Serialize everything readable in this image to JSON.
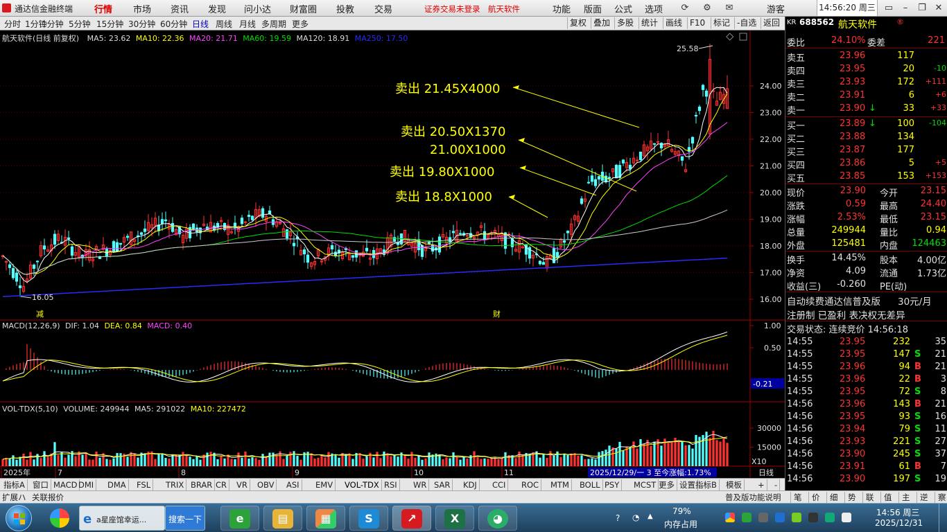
{
  "app": {
    "title": "通达信金融终端",
    "menu": [
      "行情",
      "市场",
      "资讯",
      "发现",
      "问小达",
      "财富圈",
      "投教",
      "交易"
    ],
    "notice_login": "证券交易未登录",
    "notice_stock": "航天软件",
    "right_menu": [
      "功能",
      "版面",
      "公式",
      "选项"
    ],
    "user": "游客",
    "clock": "14:56:20 周三",
    "brand_color": "#d71920"
  },
  "toolbar": {
    "periods": [
      "分时",
      "1分钟",
      "5分钟",
      "15分钟",
      "30分钟",
      "60分钟",
      "日线",
      "周线",
      "月线",
      "多周期",
      "更多"
    ],
    "active_period": "日线",
    "right_buttons": [
      "复权",
      "叠加",
      "多股",
      "统计",
      "画线",
      "F10",
      "标记",
      "-自选",
      "返回"
    ]
  },
  "chart_header": {
    "title": "航天软件(日线 前复权)",
    "ma": [
      {
        "label": "MA5:",
        "value": "23.62",
        "color": "#ffffff"
      },
      {
        "label": "MA10:",
        "value": "22.36",
        "color": "#ffff00"
      },
      {
        "label": "MA20:",
        "value": "21.71",
        "color": "#ff00ff"
      },
      {
        "label": "MA60:",
        "value": "19.59",
        "color": "#00e000"
      },
      {
        "label": "MA120:",
        "value": "18.91",
        "color": "#dddddd"
      },
      {
        "label": "MA250:",
        "value": "17.50",
        "color": "#0000ff"
      }
    ],
    "price_axis": [
      "24.00",
      "23.00",
      "22.00",
      "21.00",
      "20.00",
      "19.00",
      "18.00",
      "17.00",
      "16.00"
    ],
    "high_mark": "25.58",
    "low_mark": "16.05",
    "markers": [
      "减",
      "财"
    ]
  },
  "annotations": [
    {
      "label": "卖出",
      "value": "21.45X4000"
    },
    {
      "label": "卖出",
      "value": "20.50X1370",
      "value2": "21.00X1000"
    },
    {
      "label": "卖出",
      "value": "19.80X1000"
    },
    {
      "label": "卖出",
      "value": "18.8X1000"
    }
  ],
  "macd": {
    "title": "MACD(12,26,9)",
    "dif_label": "DIF:",
    "dif": "1.04",
    "dea_label": "DEA:",
    "dea": "0.84",
    "macd_label": "MACD:",
    "macd": "0.40",
    "axis": [
      "1.00",
      "0.50"
    ],
    "cursor": "-0.21"
  },
  "vol": {
    "title": "VOL-TDX(5,10)",
    "volume_label": "VOLUME:",
    "volume": "249944",
    "ma5_label": "MA5:",
    "ma5": "291022",
    "ma10_label": "MA10:",
    "ma10": "227472",
    "axis": [
      "30000",
      "15000"
    ],
    "unit": "X10"
  },
  "time_axis": {
    "labels": [
      "2025年",
      "7",
      "8",
      "9",
      "10",
      "11"
    ],
    "range": "2025/12/29/一 3 至今涨幅:1.73%",
    "period": "日线"
  },
  "indicator_tabs": [
    "指标A",
    "窗口",
    "MACD",
    "DMI",
    "DMA",
    "FSL",
    "TRIX",
    "BRAR",
    "CR",
    "VR",
    "OBV",
    "ASI",
    "EMV",
    "VOL-TDX",
    "RSI",
    "WR",
    "SAR",
    "KDJ",
    "CCI",
    "ROC",
    "MTM",
    "BOLL",
    "PSY",
    "MCST",
    "更多",
    "设置"
  ],
  "indicator_right": [
    "指标B",
    "模板",
    "+",
    "-"
  ],
  "status": {
    "left": [
      "扩展ハ",
      "关联报价"
    ],
    "right": "普及版功能说明",
    "keys": [
      "笔",
      "价",
      "细",
      "势",
      "联",
      "值",
      "主",
      "逆",
      "察"
    ]
  },
  "quote": {
    "tag": "KR",
    "code": "688562",
    "name": "航天软件",
    "wb_label": "委比",
    "wb": "24.10%",
    "wc_label": "委差",
    "wc": "221",
    "asks": [
      {
        "label": "卖五",
        "price": "23.96",
        "vol": "117",
        "chg": ""
      },
      {
        "label": "卖四",
        "price": "23.95",
        "vol": "20",
        "chg": "-10"
      },
      {
        "label": "卖三",
        "price": "23.93",
        "vol": "172",
        "chg": "+111"
      },
      {
        "label": "卖二",
        "price": "23.91",
        "vol": "6",
        "chg": "+6"
      },
      {
        "label": "卖一",
        "price": "23.90",
        "vol": "33",
        "chg": "+33",
        "arrow": "↓"
      }
    ],
    "bids": [
      {
        "label": "买一",
        "price": "23.89",
        "vol": "100",
        "chg": "-104",
        "arrow": "↓"
      },
      {
        "label": "买二",
        "price": "23.88",
        "vol": "134",
        "chg": ""
      },
      {
        "label": "买三",
        "price": "23.87",
        "vol": "177",
        "chg": ""
      },
      {
        "label": "买四",
        "price": "23.86",
        "vol": "5",
        "chg": "+5"
      },
      {
        "label": "买五",
        "price": "23.85",
        "vol": "153",
        "chg": "+153"
      }
    ],
    "stats": [
      {
        "l1": "现价",
        "v1": "23.90",
        "l2": "今开",
        "v2": "23.15"
      },
      {
        "l1": "涨跌",
        "v1": "0.59",
        "l2": "最高",
        "v2": "24.40"
      },
      {
        "l1": "涨幅",
        "v1": "2.53%",
        "l2": "最低",
        "v2": "23.15"
      },
      {
        "l1": "总量",
        "v1": "249944",
        "l2": "量比",
        "v2": "0.94"
      },
      {
        "l1": "外盘",
        "v1": "125481",
        "l2": "内盘",
        "v2": "124463"
      }
    ],
    "stats2": [
      {
        "l1": "换手",
        "v1": "14.45%",
        "l2": "股本",
        "v2": "4.00亿"
      },
      {
        "l1": "净资",
        "v1": "4.09",
        "l2": "流通",
        "v2": "1.73亿"
      },
      {
        "l1": "收益(三)",
        "v1": "-0.260",
        "l2": "PE(动)",
        "v2": ""
      }
    ],
    "promo1": "自动续费通达信普及版",
    "promo_price": "30元/月",
    "promo2": "注册制 已盈利 表决权无差异",
    "trade_status": "交易状态: 连续竞价 14:56:18",
    "ticks": [
      {
        "t": "14:55",
        "p": "23.95",
        "v": "232",
        "d": "",
        "n": "35"
      },
      {
        "t": "14:55",
        "p": "23.95",
        "v": "147",
        "d": "S",
        "n": "21"
      },
      {
        "t": "14:55",
        "p": "23.96",
        "v": "94",
        "d": "B",
        "n": "21"
      },
      {
        "t": "14:55",
        "p": "23.96",
        "v": "22",
        "d": "B",
        "n": "3"
      },
      {
        "t": "14:55",
        "p": "23.95",
        "v": "72",
        "d": "S",
        "n": "8"
      },
      {
        "t": "14:56",
        "p": "23.96",
        "v": "143",
        "d": "B",
        "n": "21"
      },
      {
        "t": "14:56",
        "p": "23.95",
        "v": "93",
        "d": "S",
        "n": "16"
      },
      {
        "t": "14:56",
        "p": "23.94",
        "v": "79",
        "d": "S",
        "n": "11"
      },
      {
        "t": "14:56",
        "p": "23.93",
        "v": "221",
        "d": "S",
        "n": "27"
      },
      {
        "t": "14:56",
        "p": "23.90",
        "v": "245",
        "d": "S",
        "n": "37"
      },
      {
        "t": "14:56",
        "p": "23.91",
        "v": "61",
        "d": "B",
        "n": "7"
      },
      {
        "t": "14:56",
        "p": "23.90",
        "v": "197",
        "d": "S",
        "n": "19"
      }
    ]
  },
  "taskbar": {
    "browser_tab": "a星座馆幸运...",
    "search_btn": "搜索一下",
    "mem_pct": "79%",
    "mem_label": "内存占用",
    "time": "14:56 周三",
    "date": "2025/12/31"
  }
}
